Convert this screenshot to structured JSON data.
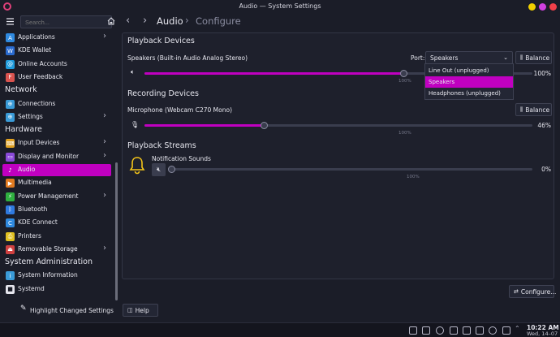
{
  "window": {
    "title": "Audio — System Settings"
  },
  "toolbar": {
    "search_placeholder": "Search...",
    "page": "Audio",
    "subpage": "Configure"
  },
  "sidebar": {
    "items": [
      {
        "label": "Applications",
        "chev": true,
        "color": "#2f8ae0",
        "icon": "A"
      },
      {
        "label": "KDE Wallet",
        "chev": false,
        "color": "#2a6bd0",
        "icon": "W"
      },
      {
        "label": "Online Accounts",
        "chev": false,
        "color": "#1f9bdc",
        "icon": "@"
      },
      {
        "label": "User Feedback",
        "chev": false,
        "color": "#d9534f",
        "icon": "F"
      }
    ],
    "cat_network": "Network",
    "network_items": [
      {
        "label": "Connections",
        "chev": false,
        "color": "#3a9bd8",
        "icon": "⊕"
      },
      {
        "label": "Settings",
        "chev": true,
        "color": "#3a9bd8",
        "icon": "⊕"
      }
    ],
    "cat_hardware": "Hardware",
    "hardware_items": [
      {
        "label": "Input Devices",
        "chev": true,
        "color": "#e0a020",
        "icon": "⌨"
      },
      {
        "label": "Display and Monitor",
        "chev": true,
        "color": "#8a4ad8",
        "icon": "▭"
      },
      {
        "label": "Audio",
        "chev": false,
        "color": "#c000c0",
        "icon": "♪",
        "active": true
      },
      {
        "label": "Multimedia",
        "chev": false,
        "color": "#e07a20",
        "icon": "▶"
      },
      {
        "label": "Power Management",
        "chev": true,
        "color": "#2fb040",
        "icon": "⚡"
      },
      {
        "label": "Bluetooth",
        "chev": false,
        "color": "#2f7ae0",
        "icon": "ᛒ"
      },
      {
        "label": "KDE Connect",
        "chev": false,
        "color": "#2f8ae0",
        "icon": "C"
      },
      {
        "label": "Printers",
        "chev": false,
        "color": "#e0c020",
        "icon": "⎙"
      },
      {
        "label": "Removable Storage",
        "chev": true,
        "color": "#d04040",
        "icon": "⏏"
      }
    ],
    "cat_sysadmin": "System Administration",
    "sysadmin_items": [
      {
        "label": "System Information",
        "chev": false,
        "color": "#3a9bd8",
        "icon": "i"
      },
      {
        "label": "Systemd",
        "chev": false,
        "color": "#e6e6ee",
        "icon": "■"
      }
    ],
    "highlight_label": "Highlight Changed Settings"
  },
  "content": {
    "playback_title": "Playback Devices",
    "speakers_label": "Speakers (Built-in Audio Analog Stereo)",
    "port_label": "Port:",
    "port_value": "Speakers",
    "balance_label": "Balance",
    "speakers_volume": 100,
    "speakers_pct": "100%",
    "tick_100": "100%",
    "recording_title": "Recording Devices",
    "mic_label": "Microphone (Webcam C270 Mono)",
    "mic_volume": 46,
    "mic_pct": "46%",
    "streams_title": "Playback Streams",
    "notif_label": "Notification Sounds",
    "notif_volume": 0,
    "notif_pct": "0%",
    "port_options": [
      "Line Out (unplugged)",
      "Speakers",
      "Headphones (unplugged)"
    ],
    "configure_label": "Configure...",
    "help_label": "Help"
  },
  "taskbar": {
    "time": "10:22 AM",
    "date": "Wed, 14–07"
  },
  "colors": {
    "accent": "#c000c0",
    "bell": "#f5c518"
  }
}
